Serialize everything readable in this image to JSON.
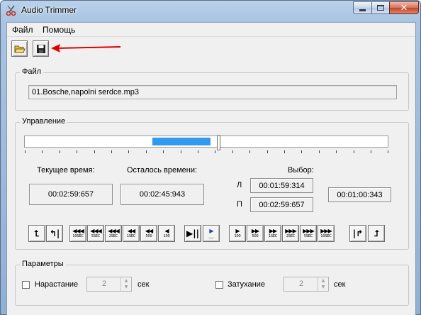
{
  "window": {
    "title": "Audio Trimmer",
    "close_symbol": "✕"
  },
  "menu": [
    {
      "label": "Файл"
    },
    {
      "label": "Помощь"
    }
  ],
  "toolbar": {
    "open_icon": "folder-open-icon",
    "save_icon": "save-disk-icon"
  },
  "file_group": {
    "legend": "Файл",
    "filename": "01.Bosche,napolni serdce.mp3"
  },
  "control_group": {
    "legend": "Управление",
    "current_time_label": "Текущее время:",
    "current_time": "00:02:59:657",
    "remaining_label": "Осталось времени:",
    "remaining_time": "00:02:45:943",
    "selection_label": "Выбор:",
    "left_marker": "Л",
    "left_time": "00:01:59:314",
    "right_marker": "П",
    "right_time": "00:02:59:657",
    "selection_length": "00:01:00:343",
    "buttons": [
      {
        "id": "set-start",
        "glyph": "⮤",
        "cap": ""
      },
      {
        "id": "go-start",
        "glyph": "↰|",
        "cap": ""
      },
      {
        "id": "back-10sec",
        "glyph": "◀◀◀",
        "cap": "10SEC"
      },
      {
        "id": "back-5sec",
        "glyph": "◀◀◀",
        "cap": "5SEC"
      },
      {
        "id": "back-2sec",
        "glyph": "◀◀◀",
        "cap": "2SEC"
      },
      {
        "id": "back-1sec",
        "glyph": "◀◀",
        "cap": "1SEC"
      },
      {
        "id": "back-500",
        "glyph": "◀◀",
        "cap": "500"
      },
      {
        "id": "back-100",
        "glyph": "◀",
        "cap": "100"
      },
      {
        "id": "pause",
        "glyph": "▶||",
        "cap": ""
      },
      {
        "id": "play",
        "glyph": "▶",
        "cap": "___"
      },
      {
        "id": "fwd-100",
        "glyph": "▶",
        "cap": "100"
      },
      {
        "id": "fwd-500",
        "glyph": "▶▶",
        "cap": "500"
      },
      {
        "id": "fwd-1sec",
        "glyph": "▶▶",
        "cap": "1SEC"
      },
      {
        "id": "fwd-2sec",
        "glyph": "▶▶▶",
        "cap": "2SEC"
      },
      {
        "id": "fwd-5sec",
        "glyph": "▶▶▶",
        "cap": "5SEC"
      },
      {
        "id": "fwd-10sec",
        "glyph": "▶▶▶",
        "cap": "10SEC"
      },
      {
        "id": "go-end",
        "glyph": "|↱",
        "cap": ""
      },
      {
        "id": "set-end",
        "glyph": "⮥",
        "cap": ""
      }
    ]
  },
  "params_group": {
    "legend": "Параметры",
    "fade_in_label": "Нарастание",
    "fade_in_value": "2",
    "fade_in_unit": "сек",
    "fade_out_label": "Затухание",
    "fade_out_value": "2",
    "fade_out_unit": "сек"
  },
  "colors": {
    "selection": "#3399ee",
    "arrow": "#e00000"
  }
}
